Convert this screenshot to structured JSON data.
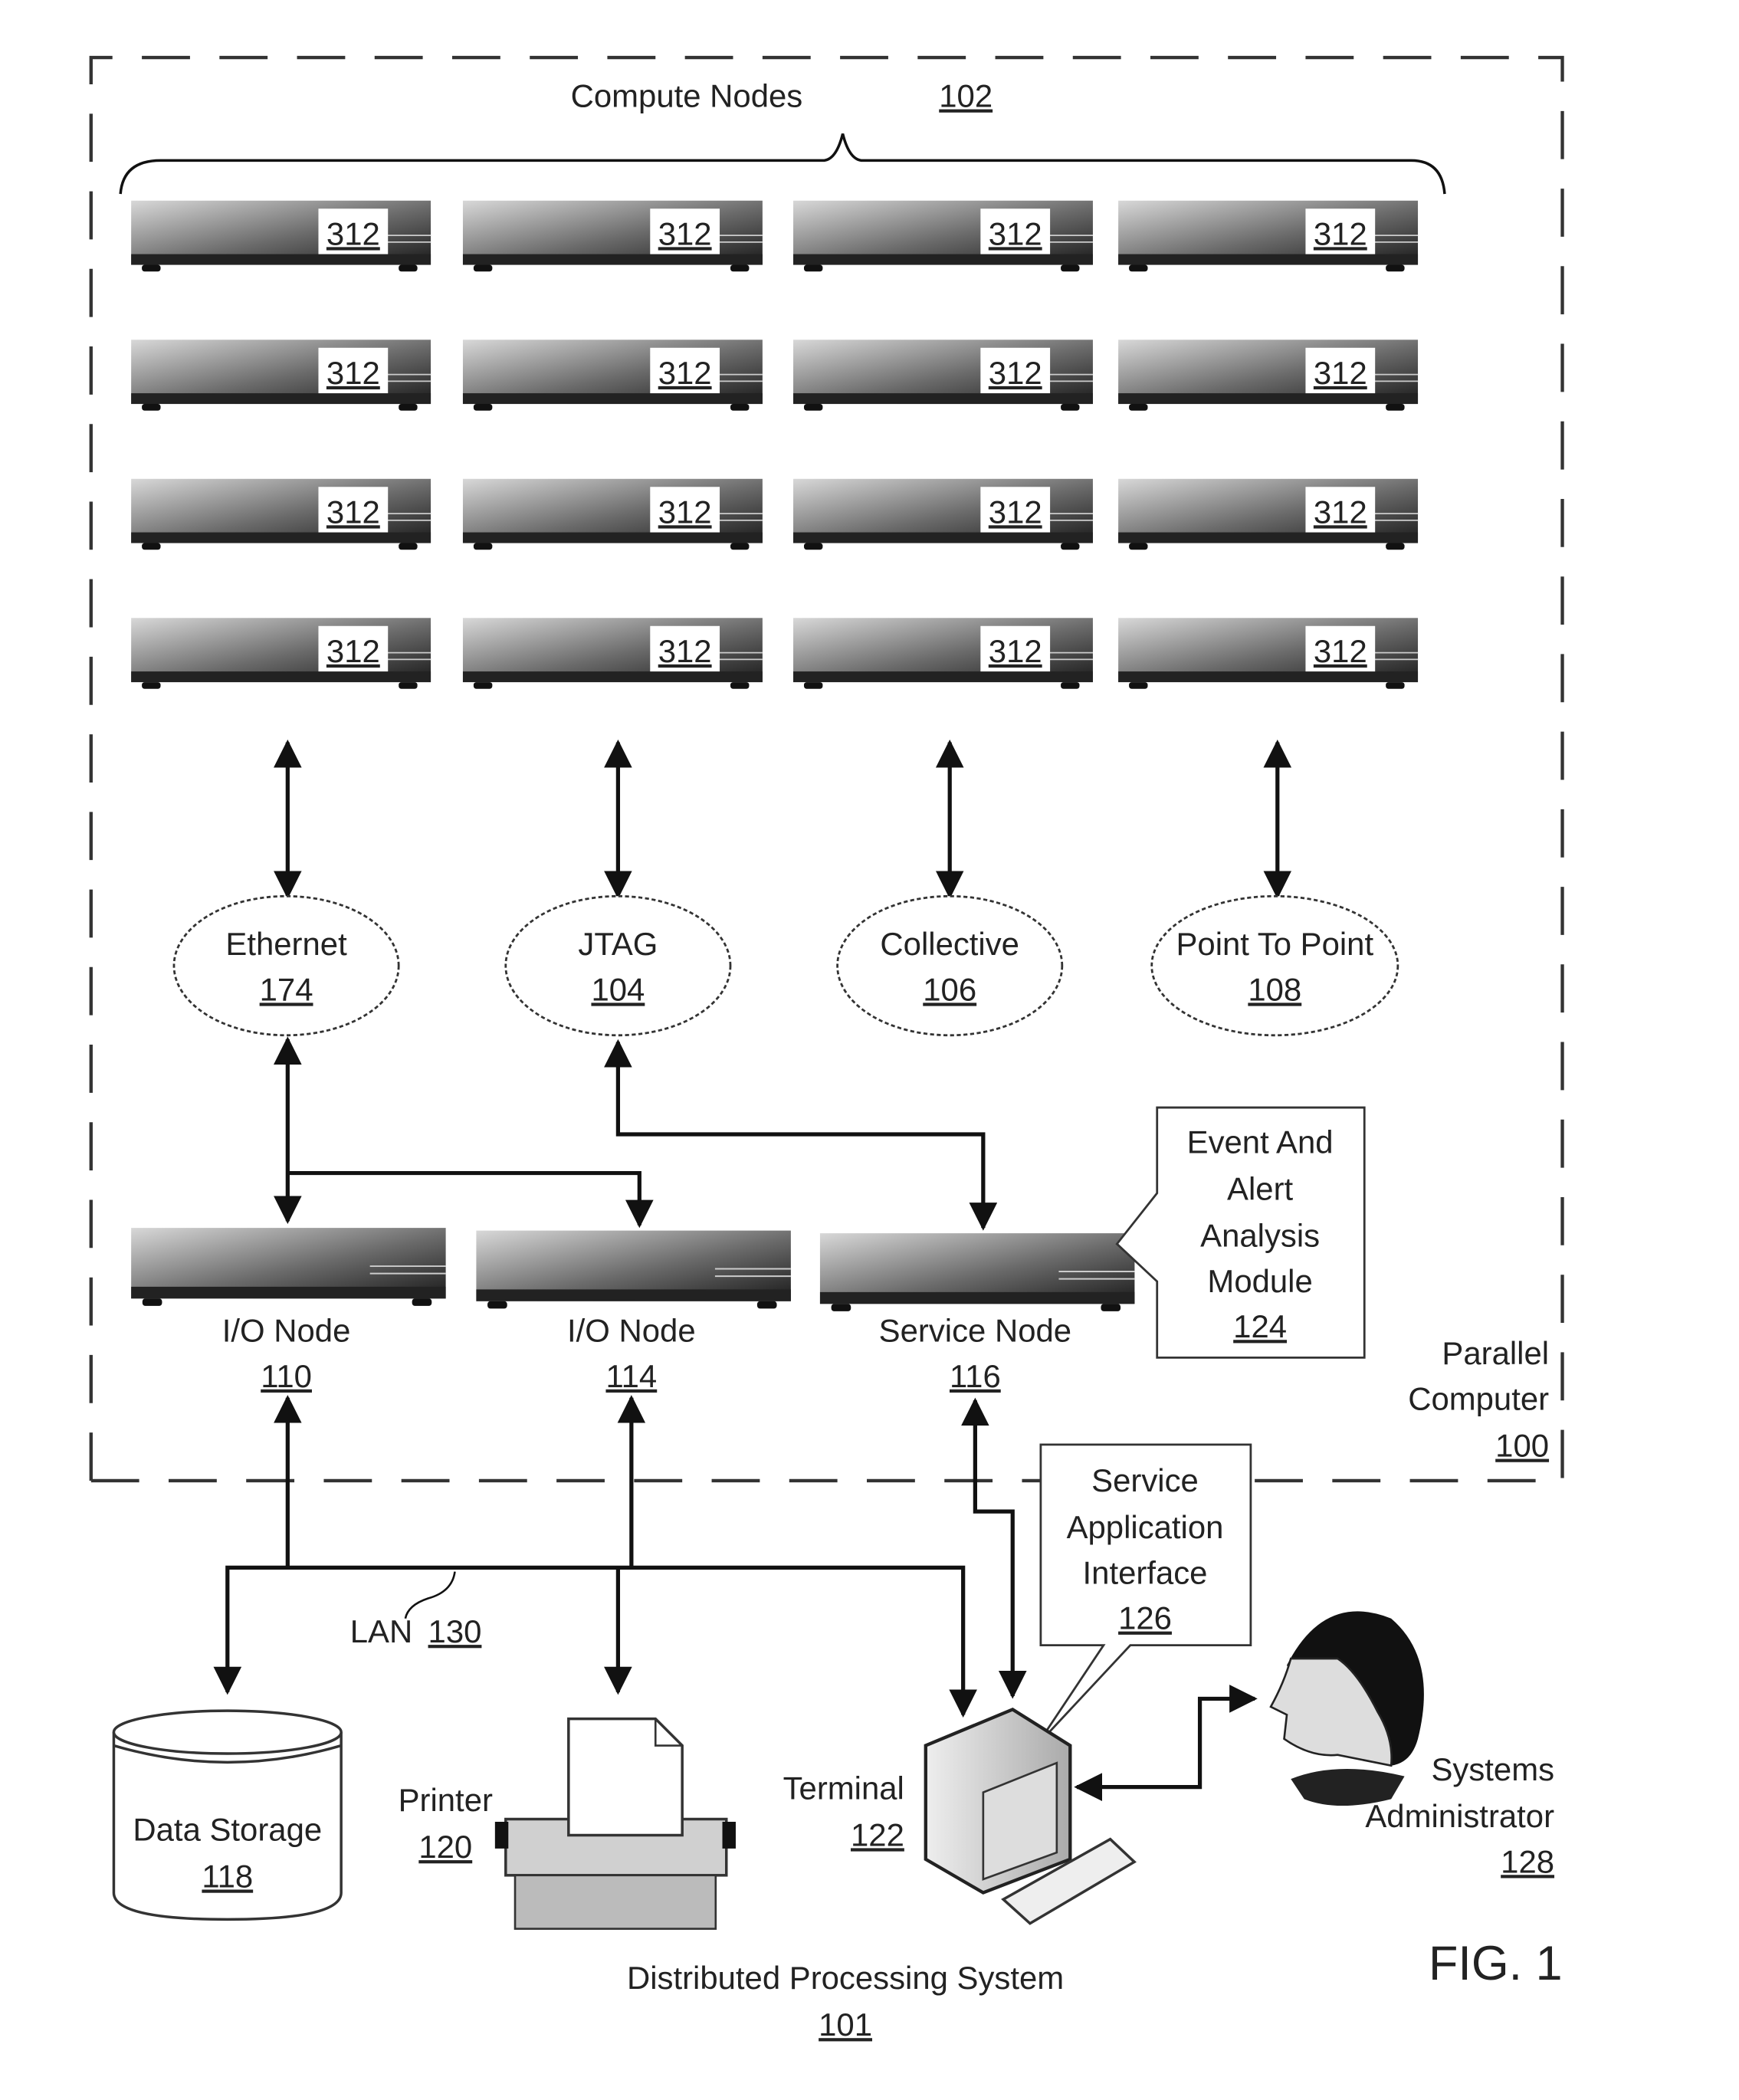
{
  "figure": {
    "label": "FIG. 1",
    "system": {
      "name": "Distributed Processing System",
      "ref": "101"
    },
    "parallel_computer": {
      "name_line1": "Parallel",
      "name_line2": "Computer",
      "ref": "100"
    },
    "compute_nodes": {
      "name": "Compute Nodes",
      "ref": "102",
      "node_ref": "312",
      "rows": 4,
      "cols": 4
    },
    "networks": [
      {
        "name": "Ethernet",
        "ref": "174"
      },
      {
        "name": "JTAG",
        "ref": "104"
      },
      {
        "name": "Collective",
        "ref": "106"
      },
      {
        "name": "Point To Point",
        "ref": "108"
      }
    ],
    "nodes": [
      {
        "name": "I/O Node",
        "ref": "110"
      },
      {
        "name": "I/O Node",
        "ref": "114"
      },
      {
        "name": "Service Node",
        "ref": "116"
      }
    ],
    "event_module": {
      "line1": "Event And",
      "line2": "Alert",
      "line3": "Analysis",
      "line4": "Module",
      "ref": "124"
    },
    "service_app": {
      "line1": "Service",
      "line2": "Application",
      "line3": "Interface",
      "ref": "126"
    },
    "lan": {
      "name": "LAN",
      "ref": "130"
    },
    "data_storage": {
      "name": "Data Storage",
      "ref": "118"
    },
    "printer": {
      "name": "Printer",
      "ref": "120"
    },
    "terminal": {
      "name": "Terminal",
      "ref": "122"
    },
    "admin": {
      "line1": "Systems",
      "line2": "Administrator",
      "ref": "128"
    }
  }
}
